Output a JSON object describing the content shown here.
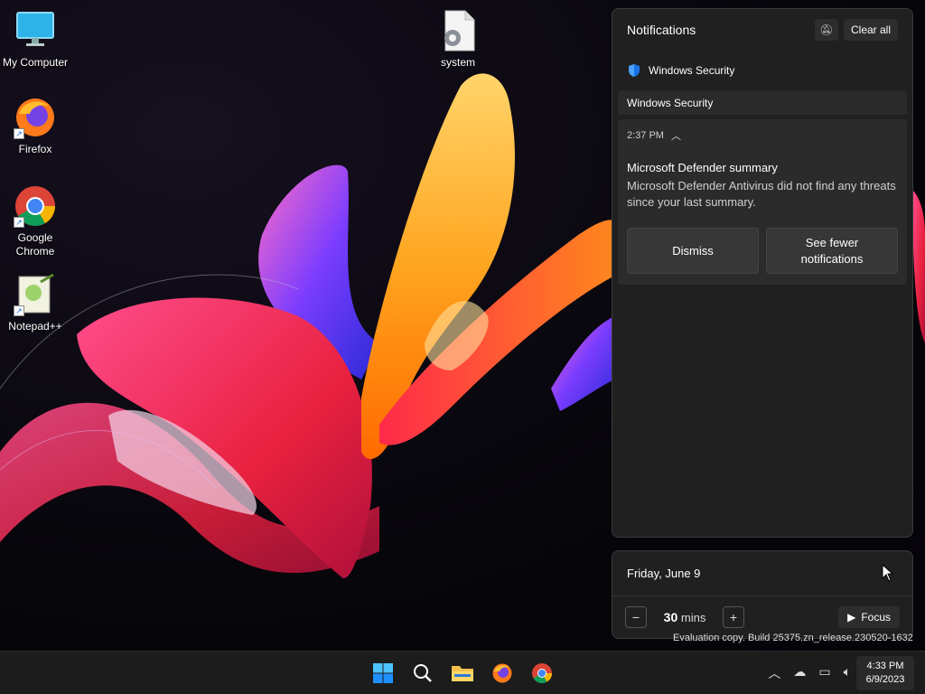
{
  "desktop": {
    "icons": [
      {
        "label": "My Computer",
        "icon": "monitor-icon"
      },
      {
        "label": "system",
        "icon": "settings-file-icon"
      },
      {
        "label": "Firefox",
        "icon": "firefox-icon"
      },
      {
        "label": "Google Chrome",
        "icon": "chrome-icon"
      },
      {
        "label": "Notepad++",
        "icon": "notepadpp-icon"
      }
    ]
  },
  "notifications": {
    "title": "Notifications",
    "clear_all_label": "Clear all",
    "app_name": "Windows Security",
    "group_title": "Windows Security",
    "toast": {
      "time": "2:37 PM",
      "title": "Microsoft Defender summary",
      "body": "Microsoft Defender Antivirus did not find any threats since your last summary.",
      "dismiss_label": "Dismiss",
      "fewer_label": "See fewer notifications"
    }
  },
  "calendar": {
    "date": "Friday, June 9",
    "focus_minutes": "30",
    "focus_unit": "mins",
    "focus_label": "Focus"
  },
  "watermark": "Evaluation copy. Build 25375.zn_release.230520-1632",
  "taskbar": {
    "clock_time": "4:33 PM",
    "clock_date": "6/9/2023",
    "items": [
      "start",
      "search",
      "file-explorer",
      "firefox",
      "chrome"
    ]
  },
  "colors": {
    "accent": "#1a73e8",
    "panel_bg": "#202020"
  }
}
